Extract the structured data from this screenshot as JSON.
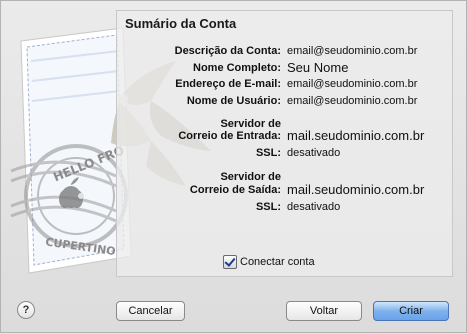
{
  "panel": {
    "title": "Sumário da Conta"
  },
  "summary": {
    "description_label": "Descrição da Conta:",
    "description_value": "email@seudominio.com.br",
    "fullname_label": "Nome Completo:",
    "fullname_value": "Seu Nome",
    "email_label": "Endereço de E-mail:",
    "email_value": "email@seudominio.com.br",
    "username_label": "Nome de Usuário:",
    "username_value": "email@seudominio.com.br",
    "incoming_label_1": "Servidor de",
    "incoming_label_2": "Correio de Entrada:",
    "incoming_value": "mail.seudominio.com.br",
    "incoming_ssl_label": "SSL:",
    "incoming_ssl_value": "desativado",
    "outgoing_label_1": "Servidor de",
    "outgoing_label_2": "Correio de Saída:",
    "outgoing_value": "mail.seudominio.com.br",
    "outgoing_ssl_label": "SSL:",
    "outgoing_ssl_value": "desativado"
  },
  "connect": {
    "label": "Conectar conta",
    "checked": true
  },
  "buttons": {
    "help": "?",
    "cancel": "Cancelar",
    "back": "Voltar",
    "create": "Criar"
  },
  "stamp": {
    "text_top": "HELLO FRO",
    "text_bottom": "CUPERTINO"
  },
  "icons": [
    "eagle-icon",
    "stamp-icon",
    "apple-icon",
    "checkmark-icon",
    "help-icon"
  ],
  "colors": {
    "primary_button": "#7fb2ec",
    "window_bg": "#e3e3e3"
  }
}
